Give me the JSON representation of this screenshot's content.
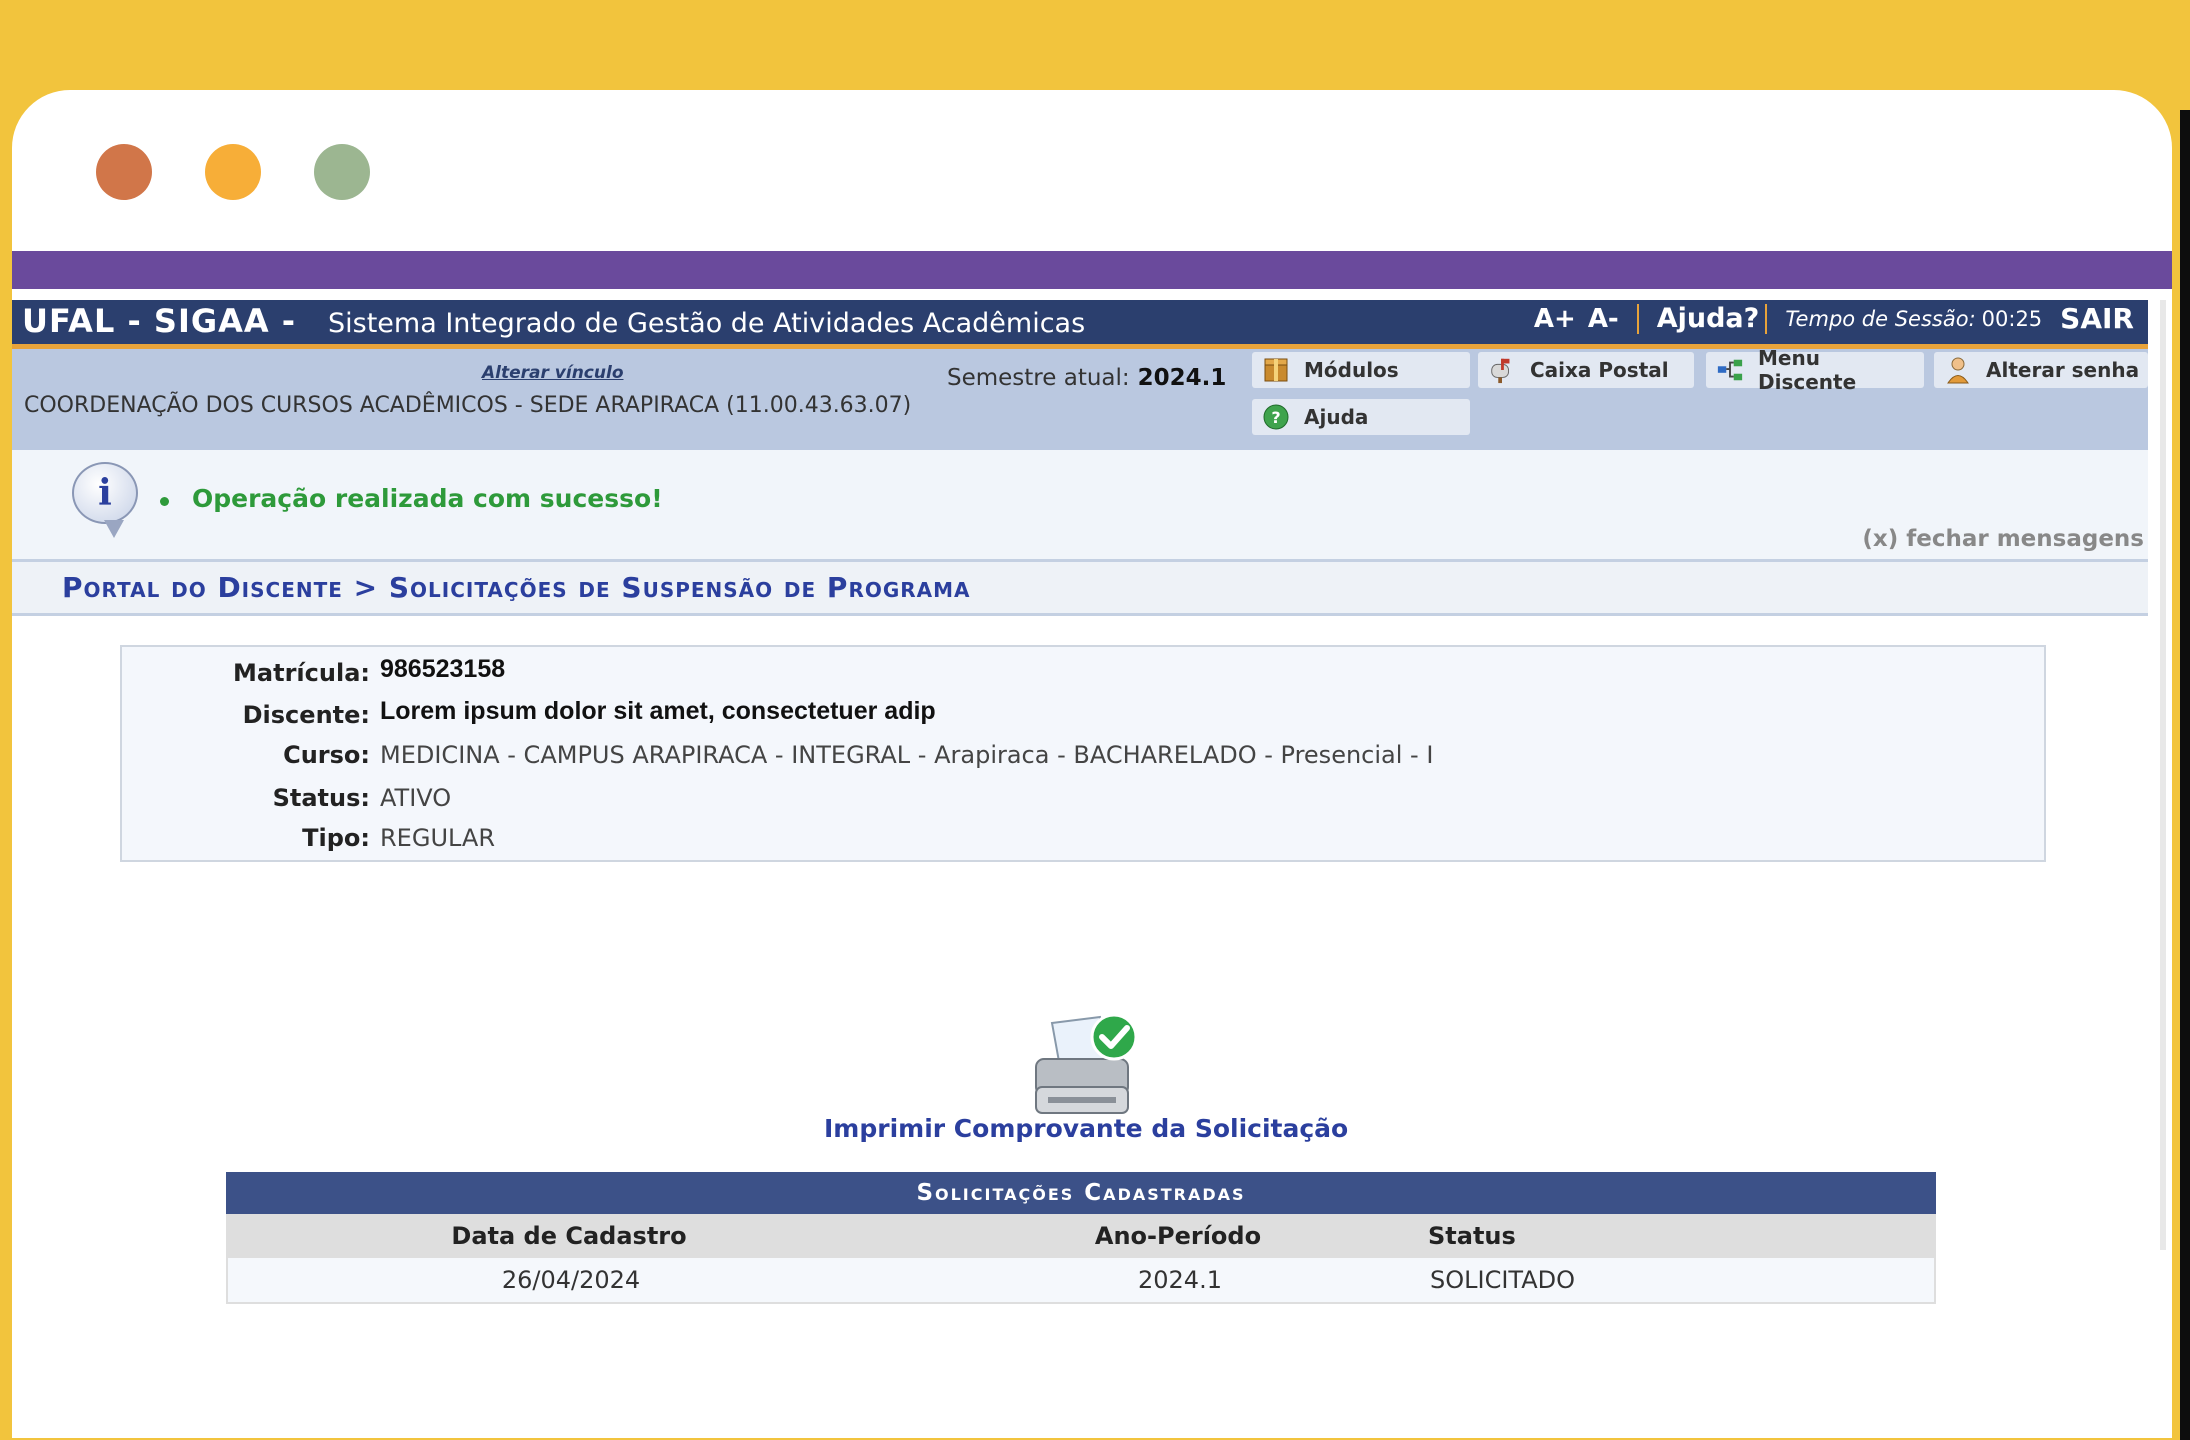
{
  "window": {
    "controls": [
      "close",
      "minimize",
      "maximize"
    ]
  },
  "topbar": {
    "brand": "UFAL - SIGAA -",
    "subtitle": "Sistema Integrado de Gestão de Atividades Acadêmicas",
    "font_increase": "A+",
    "font_decrease": "A-",
    "help": "Ajuda?",
    "session_label": "Tempo de Sessão:",
    "session_time": "00:25",
    "logout": "SAIR"
  },
  "infobar": {
    "alter_link": "Alterar vínculo",
    "unit": "COORDENAÇÃO DOS CURSOS ACADÊMICOS - SEDE ARAPIRACA (11.00.43.63.07)",
    "semester_label": "Semestre atual:",
    "semester_value": "2024.1",
    "menu": {
      "modulos": "Módulos",
      "caixa_postal": "Caixa Postal",
      "menu_discente": "Menu Discente",
      "alterar_senha": "Alterar senha",
      "ajuda": "Ajuda"
    }
  },
  "messages": {
    "success": "Operação realizada com sucesso!",
    "close": "(x) fechar mensagens"
  },
  "breadcrumb": "Portal do Discente > Solicitações de Suspensão de Programa",
  "student": {
    "matricula_label": "Matrícula:",
    "matricula": "986523158",
    "discente_label": "Discente:",
    "discente": "Lorem ipsum dolor sit amet, consectetuer adip",
    "curso_label": "Curso:",
    "curso": "MEDICINA - CAMPUS ARAPIRACA - INTEGRAL - Arapiraca - BACHARELADO - Presencial - I",
    "status_label": "Status:",
    "status": "ATIVO",
    "tipo_label": "Tipo:",
    "tipo": "REGULAR"
  },
  "print": {
    "label": "Imprimir Comprovante da Solicitação"
  },
  "table": {
    "title": "Solicitações Cadastradas",
    "headers": [
      "Data de Cadastro",
      "Ano-Período",
      "Status"
    ],
    "rows": [
      [
        "26/04/2024",
        "2024.1",
        "SOLICITADO"
      ]
    ]
  },
  "colors": {
    "background": "#F2C43D",
    "purple_bar": "#6A4A9C",
    "header": "#2B3F6E",
    "accent": "#E8A33A",
    "success": "#2E9A3A",
    "link": "#2B3F9E"
  }
}
